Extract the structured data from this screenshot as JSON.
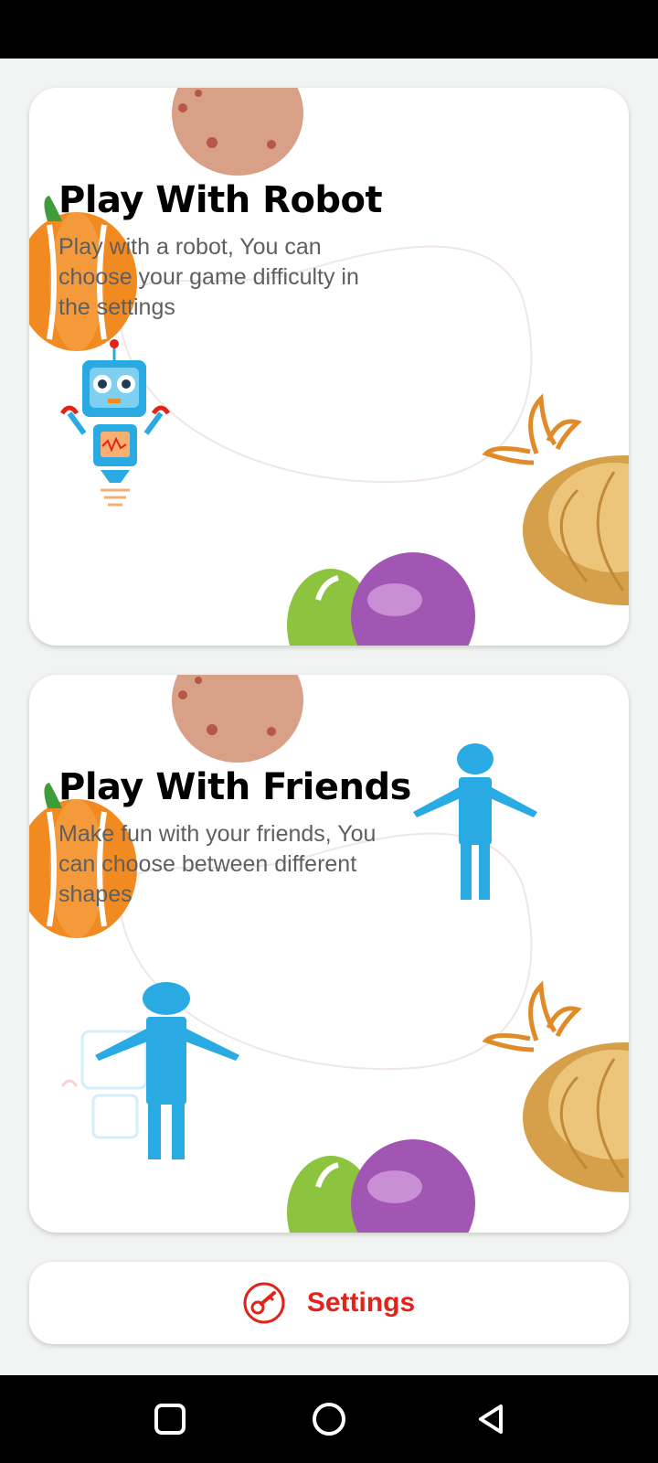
{
  "cards": [
    {
      "title": "Play With Robot",
      "description": "Play with a robot, You can choose your game difficulty in the settings"
    },
    {
      "title": "Play With Friends",
      "description": "Make fun with your friends, You can choose between different shapes"
    }
  ],
  "settings": {
    "label": "Settings",
    "icon": "key-icon"
  },
  "colors": {
    "accent_red": "#e2231a",
    "figure_blue": "#29aae2",
    "background": "#f2f4f3"
  },
  "system_nav": {
    "icons": [
      "square-icon",
      "circle-icon",
      "back-triangle-icon"
    ]
  }
}
